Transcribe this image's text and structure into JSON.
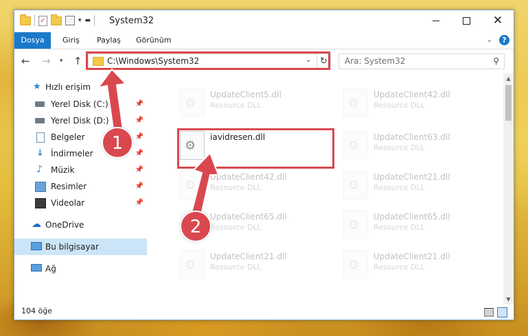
{
  "window": {
    "title": "System32"
  },
  "ribbon": {
    "tabs": [
      "Dosya",
      "Giriş",
      "Paylaş",
      "Görünüm"
    ],
    "help": "?"
  },
  "nav": {
    "address": "C:\\Windows\\System32",
    "search_placeholder": "Ara: System32"
  },
  "sidebar": {
    "items": [
      {
        "label": "Hızlı erişim",
        "icon": "star-icon"
      },
      {
        "label": "Yerel Disk (C:)",
        "icon": "drive-icon",
        "pinned": true
      },
      {
        "label": "Yerel Disk (D:)",
        "icon": "drive-icon",
        "pinned": true
      },
      {
        "label": "Belgeler",
        "icon": "documents-icon",
        "pinned": true
      },
      {
        "label": "İndirmeler",
        "icon": "downloads-icon",
        "pinned": true
      },
      {
        "label": "Müzik",
        "icon": "music-icon",
        "pinned": true
      },
      {
        "label": "Resimler",
        "icon": "pictures-icon",
        "pinned": true
      },
      {
        "label": "Videolar",
        "icon": "videos-icon",
        "pinned": true
      },
      {
        "label": "OneDrive",
        "icon": "onedrive-icon"
      },
      {
        "label": "Bu bilgisayar",
        "icon": "this-pc-icon",
        "selected": true
      },
      {
        "label": "Ağ",
        "icon": "network-icon"
      }
    ]
  },
  "files": {
    "highlighted": {
      "name": "iavidresen.dll"
    },
    "faded_left": [
      {
        "name": "UpdateClient5.dll",
        "type": "Resource DLL"
      },
      {
        "name": "UpdateClient42.dll",
        "type": "Resource DLL"
      },
      {
        "name": "UpdateClient65.dll",
        "type": "Resource DLL"
      },
      {
        "name": "UpdateClient21.dll",
        "type": "Resource DLL"
      }
    ],
    "faded_right": [
      {
        "name": "UpdateClient42.dll",
        "type": "Resource DLL"
      },
      {
        "name": "UpdateClient63.dll",
        "type": "Resource DLL"
      },
      {
        "name": "UpdateClient21.dll",
        "type": "Resource DLL"
      },
      {
        "name": "UpdateClient65.dll",
        "type": "Resource DLL"
      },
      {
        "name": "UpdateClient21.dll",
        "type": "Resource DLL"
      }
    ]
  },
  "status": {
    "count": "104 öğe"
  },
  "annotations": {
    "step1": "1",
    "step2": "2",
    "color": "#d9484f"
  }
}
